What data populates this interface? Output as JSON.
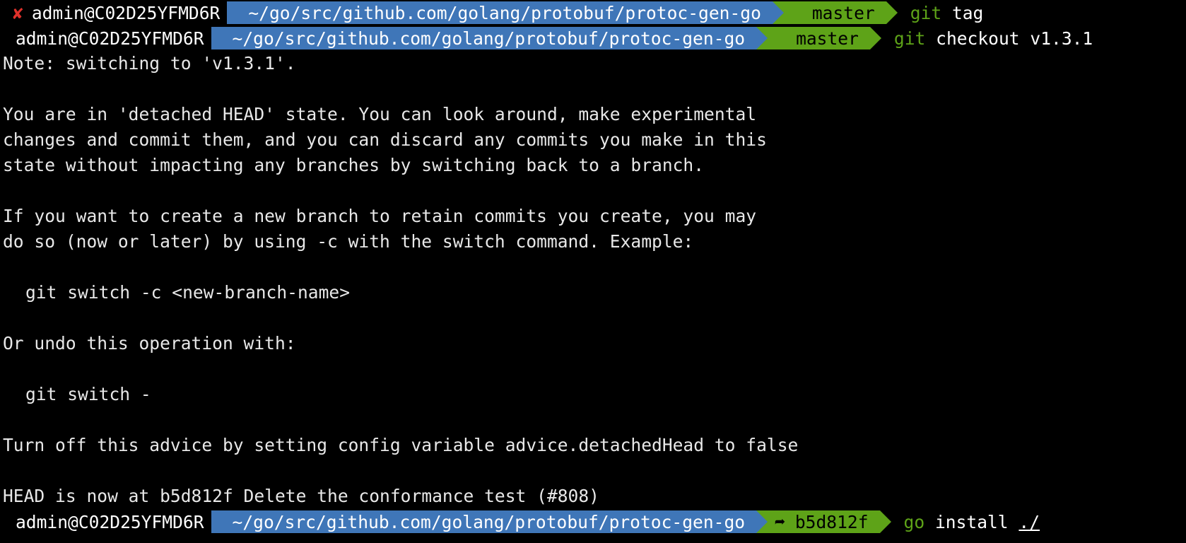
{
  "colors": {
    "background": "#000000",
    "text": "#e8e8e8",
    "path_segment": "#3f76b8",
    "git_segment": "#5ea318",
    "command_name": "#5ea318",
    "error_status": "#e0312b"
  },
  "prompts": [
    {
      "status_icon": "✘",
      "user_host": "admin@C02D25YFMD6R",
      "path": "~/go/src/github.com/golang/protobuf/protoc-gen-go",
      "git_icon": "branch-icon",
      "git_ref": "master",
      "command": "git",
      "args": " tag"
    },
    {
      "user_host": "admin@C02D25YFMD6R",
      "path": "~/go/src/github.com/golang/protobuf/protoc-gen-go",
      "git_icon": "branch-icon",
      "git_ref": "master",
      "command": "git",
      "args": " checkout v1.3.1"
    },
    {
      "user_host": "admin@C02D25YFMD6R",
      "path": "~/go/src/github.com/golang/protobuf/protoc-gen-go",
      "git_icon": "detached-arrow-icon",
      "git_ref_icon_glyph": "➦",
      "git_ref": "b5d812f",
      "command": "go",
      "args_plain": " install ",
      "args_underlined": "./"
    }
  ],
  "output": {
    "line_01": "Note: switching to 'v1.3.1'.",
    "line_03": "You are in 'detached HEAD' state. You can look around, make experimental",
    "line_04": "changes and commit them, and you can discard any commits you make in this",
    "line_05": "state without impacting any branches by switching back to a branch.",
    "line_07": "If you want to create a new branch to retain commits you create, you may",
    "line_08": "do so (now or later) by using -c with the switch command. Example:",
    "line_10": "git switch -c <new-branch-name>",
    "line_12": "Or undo this operation with:",
    "line_14": "git switch -",
    "line_16": "Turn off this advice by setting config variable advice.detachedHead to false",
    "line_18": "HEAD is now at b5d812f Delete the conformance test (#808)"
  }
}
